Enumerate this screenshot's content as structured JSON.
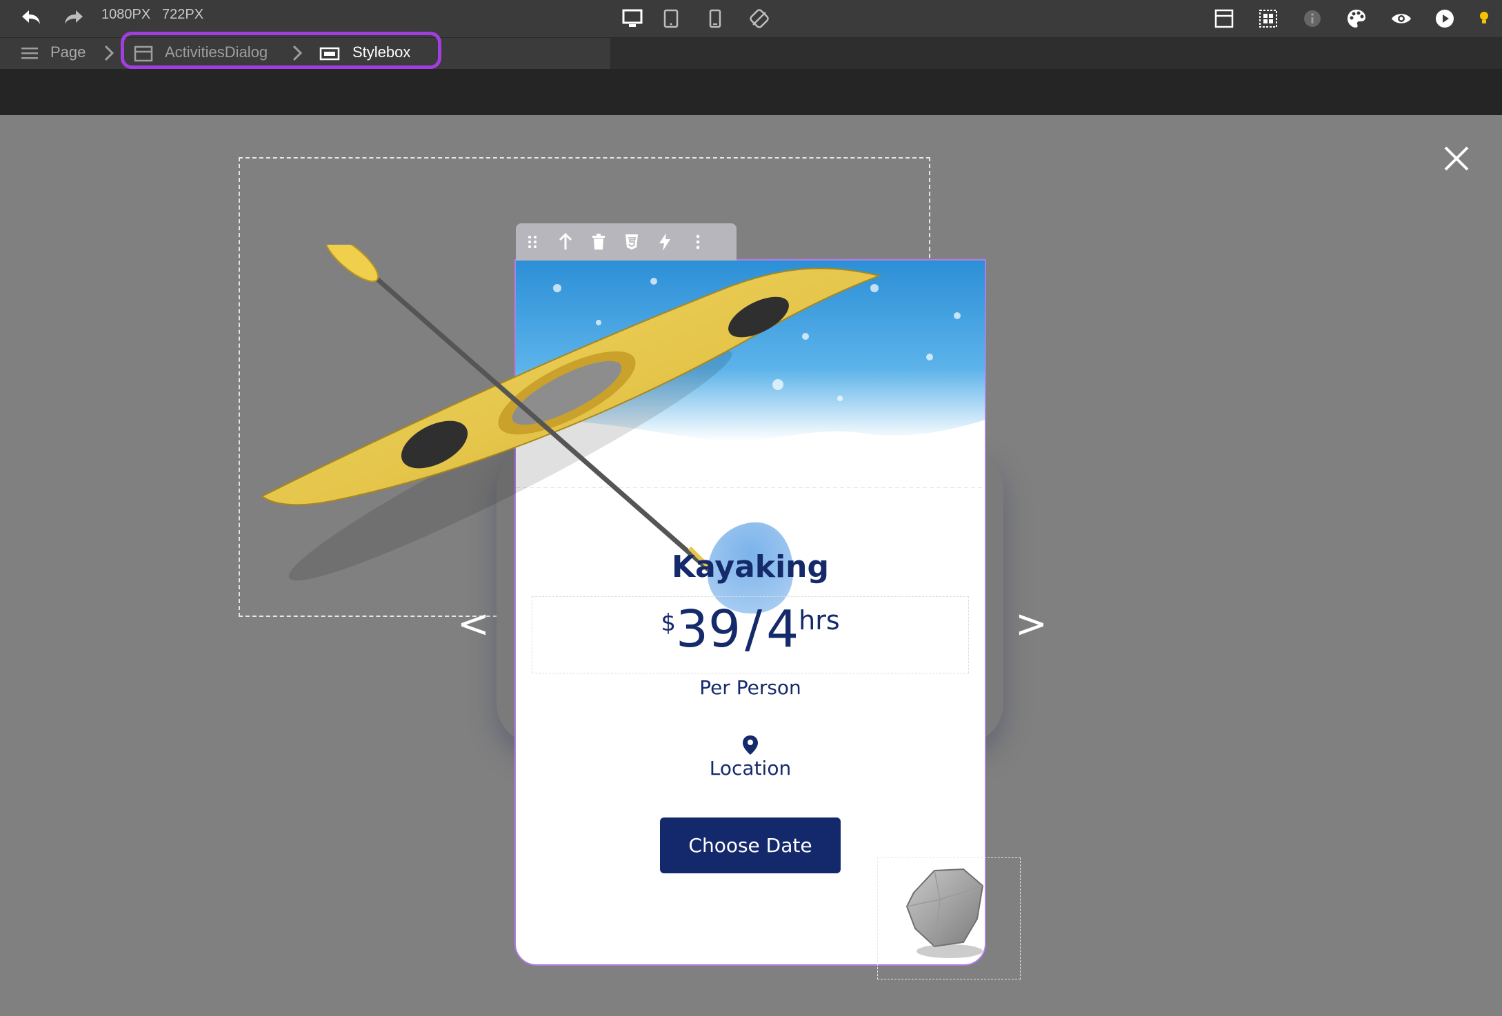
{
  "toolbar": {
    "width_label": "1080PX",
    "height_label": "722PX",
    "undo_icon": "undo-icon",
    "redo_icon": "redo-icon",
    "device_icons": [
      "desktop-icon",
      "tablet-icon",
      "mobile-icon",
      "responsive-off-icon"
    ],
    "right_icons": [
      "layout-icon",
      "grid-icon",
      "info-icon",
      "palette-icon",
      "preview-eye-icon",
      "play-icon",
      "hint-bulb-icon"
    ]
  },
  "breadcrumb": {
    "items": [
      "Page",
      "ActivitiesDialog",
      "Stylebox"
    ],
    "highlight_color": "#a23ee0"
  },
  "element_toolbar": {
    "icons": [
      "drag-handle-icon",
      "select-parent-icon",
      "delete-icon",
      "css-icon",
      "action-bolt-icon",
      "more-options-icon"
    ]
  },
  "card": {
    "title": "Kayaking",
    "price": {
      "currency": "$",
      "amount": "39",
      "separator": "/",
      "duration": "4",
      "unit": "hrs"
    },
    "per_person": "Per Person",
    "location_label": "Location",
    "cta_label": "Choose Date",
    "accent_color": "#14296b"
  },
  "navigation": {
    "prev": "<",
    "next": ">"
  },
  "colors": {
    "canvas": "#808080",
    "topbar": "#3b3b3b",
    "selection": "#b07ee8"
  }
}
